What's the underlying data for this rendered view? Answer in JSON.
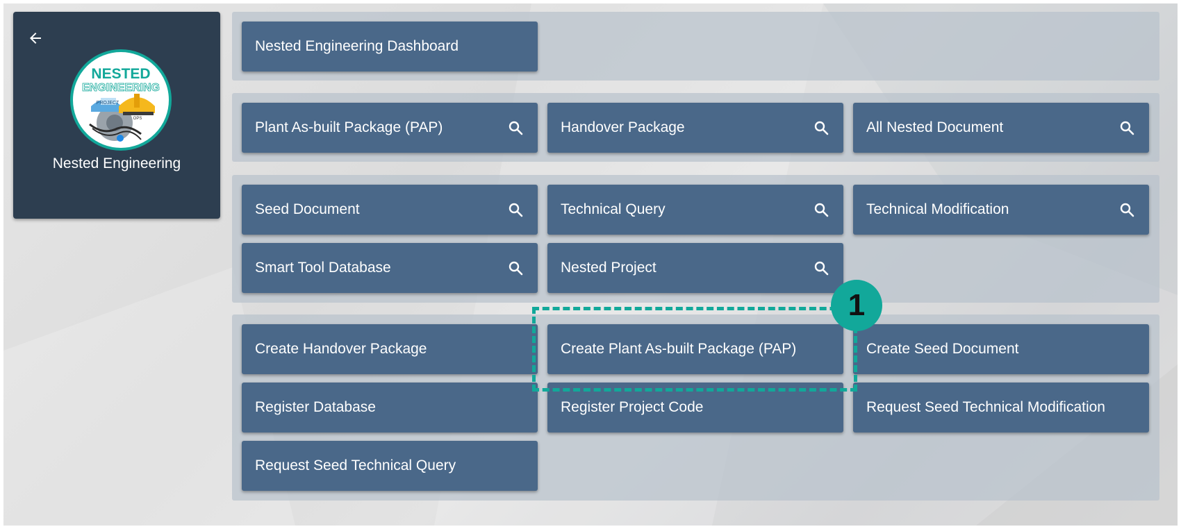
{
  "sidebar": {
    "title": "Nested Engineering",
    "logo": {
      "line1": "NESTED",
      "line2": "ENGINEERING",
      "tag1": "PROJECT",
      "tag2": "OPS"
    }
  },
  "groups": {
    "dashboard": {
      "items": [
        {
          "label": "Nested Engineering Dashboard"
        }
      ]
    },
    "packages": {
      "items": [
        {
          "label": "Plant As-built Package (PAP)",
          "icon": "search-icon"
        },
        {
          "label": "Handover Package",
          "icon": "search-icon"
        },
        {
          "label": "All Nested Document",
          "icon": "search-icon"
        }
      ]
    },
    "documents": {
      "items": [
        {
          "label": "Seed Document",
          "icon": "search-icon"
        },
        {
          "label": "Technical Query",
          "icon": "search-icon"
        },
        {
          "label": "Technical Modification",
          "icon": "search-icon"
        },
        {
          "label": "Smart Tool Database",
          "icon": "search-icon"
        },
        {
          "label": "Nested Project",
          "icon": "search-icon"
        }
      ]
    },
    "actions": {
      "items": [
        {
          "label": "Create Handover Package"
        },
        {
          "label": "Create Plant As-built Package (PAP)"
        },
        {
          "label": "Create Seed Document"
        },
        {
          "label": "Register Database"
        },
        {
          "label": "Register Project Code"
        },
        {
          "label": "Request Seed Technical Modification"
        },
        {
          "label": "Request Seed Technical Query"
        }
      ]
    }
  },
  "annotation": {
    "badge": "1"
  },
  "colors": {
    "tile": "#4a6889",
    "sidebar": "#2d3e50",
    "accent": "#12a89a"
  }
}
